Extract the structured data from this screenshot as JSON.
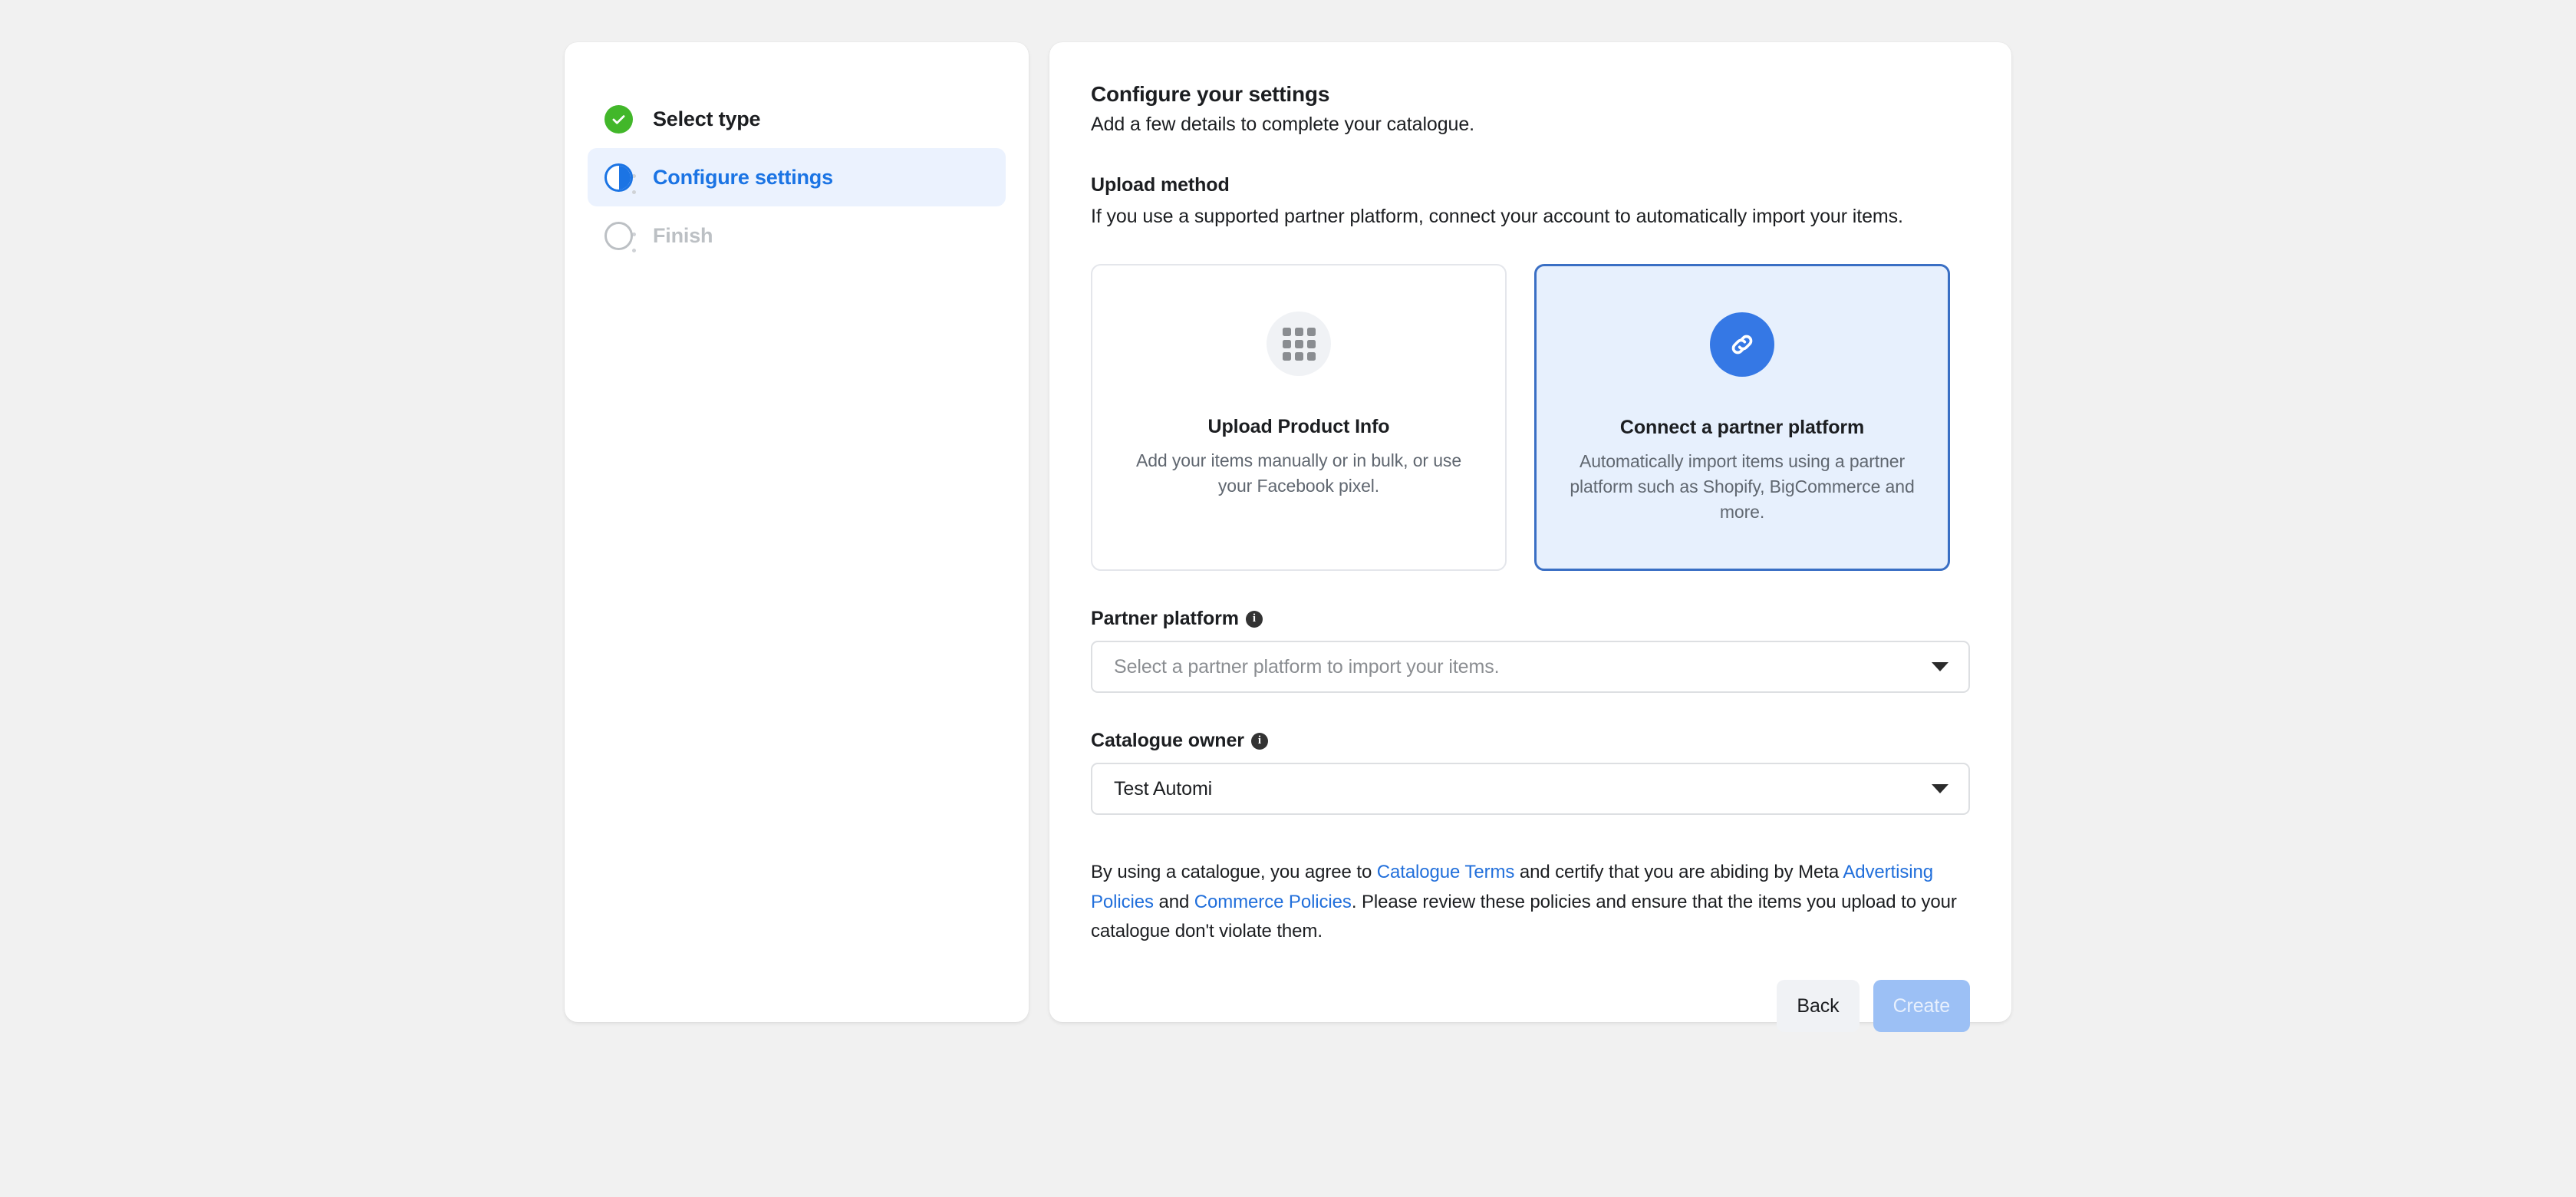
{
  "stepper": {
    "steps": [
      {
        "label": "Select type",
        "state": "done",
        "icon": "check-circle-icon"
      },
      {
        "label": "Configure settings",
        "state": "active",
        "icon": "half-filled-circle-icon"
      },
      {
        "label": "Finish",
        "state": "todo",
        "icon": "empty-circle-icon"
      }
    ]
  },
  "content": {
    "title": "Configure your settings",
    "subtitle": "Add a few details to complete your catalogue.",
    "upload_method": {
      "section_title": "Upload method",
      "section_desc": "If you use a supported partner platform, connect your account to automatically import your items.",
      "options": [
        {
          "title": "Upload Product Info",
          "description": "Add your items manually or in bulk, or use your Facebook pixel.",
          "icon": "grid-icon",
          "selected": false
        },
        {
          "title": "Connect a partner platform",
          "description": "Automatically import items using a partner platform such as Shopify, BigCommerce and more.",
          "icon": "link-icon",
          "selected": true
        }
      ]
    },
    "fields": [
      {
        "label": "Partner platform",
        "info_icon": "info-icon",
        "placeholder": "Select a partner platform to import your items.",
        "value": "",
        "caret": "chevron-down-icon"
      },
      {
        "label": "Catalogue owner",
        "info_icon": "info-icon",
        "placeholder": "",
        "value": "Test Automi",
        "caret": "chevron-down-icon"
      }
    ],
    "legal": {
      "part1": "By using a catalogue, you agree to ",
      "link1": "Catalogue Terms",
      "part2": " and certify that you are abiding by Meta ",
      "link2": "Advertising Policies",
      "part3": " and ",
      "link3": "Commerce Policies",
      "part4": ". Please review these policies and ensure that the items you upload to your catalogue don't violate them."
    },
    "footer": {
      "back_label": "Back",
      "create_label": "Create"
    }
  },
  "colors": {
    "accent_blue": "#1b74e4",
    "icon_blue": "#3578e5",
    "selected_border": "#3a6fc4",
    "selected_bg": "#e7f0fd",
    "success_green": "#42b72a",
    "link_blue": "#216fdb",
    "muted_grey": "#bcc0c4",
    "page_bg": "#f1f1f1"
  }
}
